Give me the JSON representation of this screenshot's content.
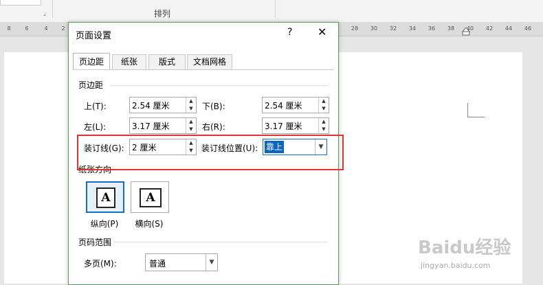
{
  "ribbon": {
    "group_label": "排列",
    "launcher_icon": "dialog-launcher-icon"
  },
  "ruler": {
    "left_ticks": [
      "8",
      "6",
      "4",
      "2"
    ],
    "right_ticks": [
      "28",
      "30",
      "32",
      "34",
      "36",
      "38",
      "40",
      "42",
      "44",
      "46"
    ]
  },
  "dialog": {
    "title": "页面设置",
    "help": "?",
    "close": "✕",
    "tabs": [
      {
        "label": "页边距",
        "active": true
      },
      {
        "label": "纸张",
        "active": false
      },
      {
        "label": "版式",
        "active": false
      },
      {
        "label": "文档网格",
        "active": false
      }
    ],
    "margins": {
      "section": "页边距",
      "top": {
        "label": "上(T):",
        "value": "2.54 厘米"
      },
      "bottom": {
        "label": "下(B):",
        "value": "2.54 厘米"
      },
      "left": {
        "label": "左(L):",
        "value": "3.17 厘米"
      },
      "right": {
        "label": "右(R):",
        "value": "3.17 厘米"
      },
      "gutter": {
        "label": "装订线(G):",
        "value": "2 厘米"
      },
      "gutter_position": {
        "label": "装订线位置(U):",
        "value": "靠上"
      }
    },
    "orientation": {
      "section": "纸张方向",
      "portrait": {
        "label": "纵向(P)",
        "glyph": "A",
        "selected": true
      },
      "landscape": {
        "label": "横向(S)",
        "glyph": "A",
        "selected": false
      }
    },
    "pages": {
      "section": "页码范围",
      "multiple_label": "多页(M):",
      "multiple_value": "普通"
    }
  },
  "watermark": {
    "brand": "Baidu经验",
    "url": "jingyan.baidu.com"
  },
  "colors": {
    "highlight_border": "#e23232",
    "selection": "#0a64c8",
    "dialog_border": "#5c9a5c"
  }
}
